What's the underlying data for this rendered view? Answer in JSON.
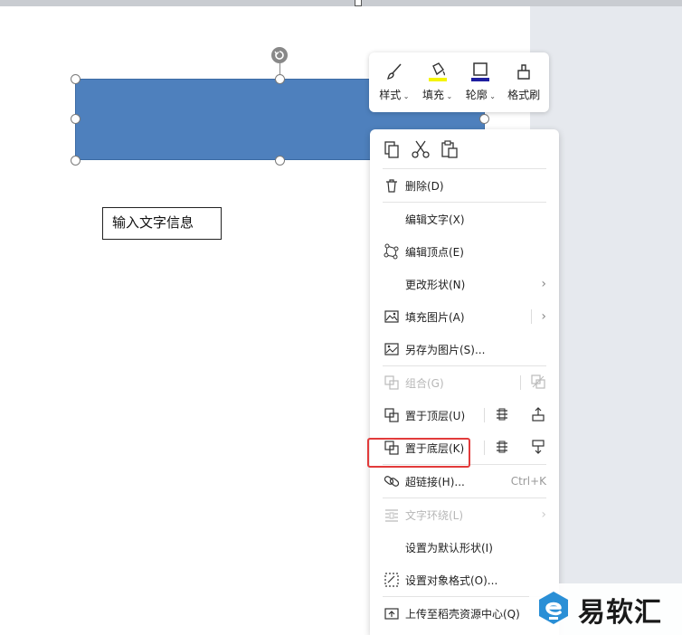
{
  "textbox": {
    "text": "输入文字信息"
  },
  "mini_toolbar": {
    "items": [
      {
        "label": "样式",
        "icon": "brush-icon"
      },
      {
        "label": "填充",
        "icon": "fill-bucket-icon",
        "color": "#f5f500"
      },
      {
        "label": "轮廓",
        "icon": "outline-icon",
        "color": "#1f1fa0"
      },
      {
        "label": "格式刷",
        "icon": "format-painter-icon"
      }
    ]
  },
  "context_menu": {
    "clipboard": [
      "copy-icon",
      "cut-icon",
      "paste-icon"
    ],
    "items": [
      {
        "label": "删除(D)",
        "icon": "trash-icon"
      },
      {
        "label": "编辑文字(X)"
      },
      {
        "label": "编辑顶点(E)",
        "icon": "vertex-icon"
      },
      {
        "label": "更改形状(N)",
        "submenu": true
      },
      {
        "label": "填充图片(A)",
        "icon": "image-fill-icon",
        "submenu": true
      },
      {
        "label": "另存为图片(S)...",
        "icon": "save-image-icon"
      },
      {
        "label": "组合(G)",
        "icon": "group-icon",
        "disabled": true
      },
      {
        "label": "置于顶层(U)",
        "icon": "bring-front-icon"
      },
      {
        "label": "置于底层(K)",
        "icon": "send-back-icon",
        "highlighted": true
      },
      {
        "label": "超链接(H)...",
        "icon": "link-icon",
        "shortcut": "Ctrl+K"
      },
      {
        "label": "文字环绕(L)",
        "icon": "wrap-icon",
        "disabled": true,
        "submenu": true
      },
      {
        "label": "设置为默认形状(I)"
      },
      {
        "label": "设置对象格式(O)...",
        "icon": "format-object-icon"
      },
      {
        "label": "上传至稻壳资源中心(Q)",
        "icon": "upload-icon"
      }
    ]
  },
  "highlight_color": "#e23b3b",
  "shape_color": "#4e80bd",
  "watermark": {
    "text": "易软汇",
    "logo_color": "#2a8fd6"
  }
}
